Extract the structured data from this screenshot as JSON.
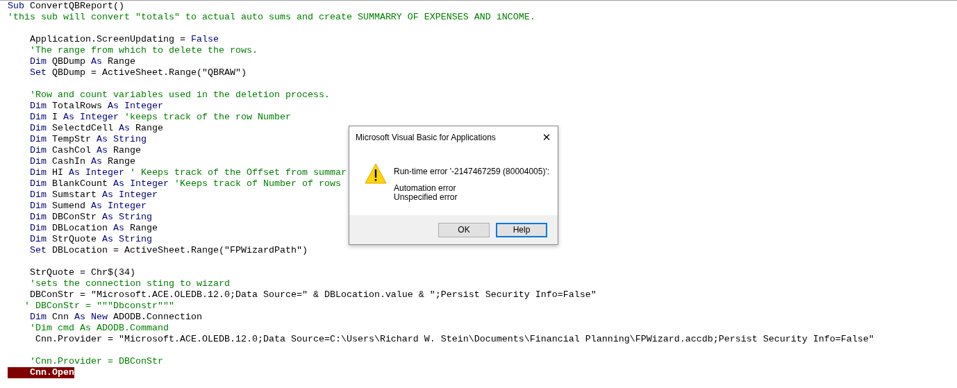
{
  "code_editor": {
    "lines": [
      {
        "kind": "code",
        "current": false,
        "segments": [
          {
            "kind": "keyword",
            "text": "Sub"
          },
          {
            "kind": "plain",
            "text": " ConvertQBReport()"
          }
        ]
      },
      {
        "kind": "code",
        "current": false,
        "segments": [
          {
            "kind": "comment",
            "text": "'this sub will convert \"totals\" to actual auto sums and create SUMMARRY OF EXPENSES AND iNCOME."
          }
        ]
      },
      {
        "kind": "blank"
      },
      {
        "kind": "code",
        "current": false,
        "segments": [
          {
            "kind": "plain",
            "text": "    Application.ScreenUpdating = "
          },
          {
            "kind": "keyword",
            "text": "False"
          }
        ]
      },
      {
        "kind": "code",
        "current": false,
        "segments": [
          {
            "kind": "comment",
            "text": "    'The range from which to delete the rows."
          }
        ]
      },
      {
        "kind": "code",
        "current": false,
        "segments": [
          {
            "kind": "keyword",
            "text": "    Dim"
          },
          {
            "kind": "plain",
            "text": " QBDump "
          },
          {
            "kind": "keyword",
            "text": "As"
          },
          {
            "kind": "plain",
            "text": " Range"
          }
        ]
      },
      {
        "kind": "code",
        "current": false,
        "segments": [
          {
            "kind": "keyword",
            "text": "    Set"
          },
          {
            "kind": "plain",
            "text": " QBDump = ActiveSheet.Range(\"QBRAW\")"
          }
        ]
      },
      {
        "kind": "blank"
      },
      {
        "kind": "code",
        "current": false,
        "segments": [
          {
            "kind": "comment",
            "text": "    'Row and count variables used in the deletion process."
          }
        ]
      },
      {
        "kind": "code",
        "current": false,
        "segments": [
          {
            "kind": "keyword",
            "text": "    Dim"
          },
          {
            "kind": "plain",
            "text": " TotalRows "
          },
          {
            "kind": "keyword",
            "text": "As Integer"
          }
        ]
      },
      {
        "kind": "code",
        "current": false,
        "segments": [
          {
            "kind": "keyword",
            "text": "    Dim"
          },
          {
            "kind": "plain",
            "text": " I "
          },
          {
            "kind": "keyword",
            "text": "As Integer"
          },
          {
            "kind": "comment",
            "text": " 'keeps track of the row Number"
          }
        ]
      },
      {
        "kind": "code",
        "current": false,
        "segments": [
          {
            "kind": "keyword",
            "text": "    Dim"
          },
          {
            "kind": "plain",
            "text": " SelectdCell "
          },
          {
            "kind": "keyword",
            "text": "As"
          },
          {
            "kind": "plain",
            "text": " Range"
          }
        ]
      },
      {
        "kind": "code",
        "current": false,
        "segments": [
          {
            "kind": "keyword",
            "text": "    Dim"
          },
          {
            "kind": "plain",
            "text": " TempStr "
          },
          {
            "kind": "keyword",
            "text": "As String"
          }
        ]
      },
      {
        "kind": "code",
        "current": false,
        "segments": [
          {
            "kind": "keyword",
            "text": "    Dim"
          },
          {
            "kind": "plain",
            "text": " CashCol "
          },
          {
            "kind": "keyword",
            "text": "As"
          },
          {
            "kind": "plain",
            "text": " Range"
          }
        ]
      },
      {
        "kind": "code",
        "current": false,
        "segments": [
          {
            "kind": "keyword",
            "text": "    Dim"
          },
          {
            "kind": "plain",
            "text": " CashIn "
          },
          {
            "kind": "keyword",
            "text": "As"
          },
          {
            "kind": "plain",
            "text": " Range"
          }
        ]
      },
      {
        "kind": "code",
        "current": false,
        "segments": [
          {
            "kind": "keyword",
            "text": "    Dim"
          },
          {
            "kind": "plain",
            "text": " HI "
          },
          {
            "kind": "keyword",
            "text": "As Integer"
          },
          {
            "kind": "comment",
            "text": " ' Keeps track of the Offset from summar"
          }
        ]
      },
      {
        "kind": "code",
        "current": false,
        "segments": [
          {
            "kind": "keyword",
            "text": "    Dim"
          },
          {
            "kind": "plain",
            "text": " BlankCount "
          },
          {
            "kind": "keyword",
            "text": "As Integer"
          },
          {
            "kind": "comment",
            "text": " 'Keeps track of Number of rows"
          }
        ]
      },
      {
        "kind": "code",
        "current": false,
        "segments": [
          {
            "kind": "keyword",
            "text": "    Dim"
          },
          {
            "kind": "plain",
            "text": " Sumstart "
          },
          {
            "kind": "keyword",
            "text": "As Integer"
          }
        ]
      },
      {
        "kind": "code",
        "current": false,
        "segments": [
          {
            "kind": "keyword",
            "text": "    Dim"
          },
          {
            "kind": "plain",
            "text": " Sumend "
          },
          {
            "kind": "keyword",
            "text": "As Integer"
          }
        ]
      },
      {
        "kind": "code",
        "current": false,
        "segments": [
          {
            "kind": "keyword",
            "text": "    Dim"
          },
          {
            "kind": "plain",
            "text": " DBConStr "
          },
          {
            "kind": "keyword",
            "text": "As String"
          }
        ]
      },
      {
        "kind": "code",
        "current": false,
        "segments": [
          {
            "kind": "keyword",
            "text": "    Dim"
          },
          {
            "kind": "plain",
            "text": " DBLocation "
          },
          {
            "kind": "keyword",
            "text": "As"
          },
          {
            "kind": "plain",
            "text": " Range"
          }
        ]
      },
      {
        "kind": "code",
        "current": false,
        "segments": [
          {
            "kind": "keyword",
            "text": "    Dim"
          },
          {
            "kind": "plain",
            "text": " StrQuote "
          },
          {
            "kind": "keyword",
            "text": "As String"
          }
        ]
      },
      {
        "kind": "code",
        "current": false,
        "segments": [
          {
            "kind": "keyword",
            "text": "    Set"
          },
          {
            "kind": "plain",
            "text": " DBLocation = ActiveSheet.Range(\"FPWizardPath\")"
          }
        ]
      },
      {
        "kind": "blank"
      },
      {
        "kind": "code",
        "current": false,
        "segments": [
          {
            "kind": "plain",
            "text": "    StrQuote = Chr$(34)"
          }
        ]
      },
      {
        "kind": "code",
        "current": false,
        "segments": [
          {
            "kind": "comment",
            "text": "    'sets the connection sting to wizard"
          }
        ]
      },
      {
        "kind": "code",
        "current": false,
        "segments": [
          {
            "kind": "plain",
            "text": "    DBConStr = \"Microsoft.ACE.OLEDB.12.0;Data Source=\" & DBLocation.value & \";Persist Security Info=False\""
          }
        ]
      },
      {
        "kind": "code",
        "current": false,
        "segments": [
          {
            "kind": "comment",
            "text": "   ' DBConStr = \"\"\"Dbconstr\"\"\""
          }
        ]
      },
      {
        "kind": "code",
        "current": false,
        "segments": [
          {
            "kind": "keyword",
            "text": "    Dim"
          },
          {
            "kind": "plain",
            "text": " Cnn "
          },
          {
            "kind": "keyword",
            "text": "As New"
          },
          {
            "kind": "plain",
            "text": " ADODB.Connection"
          }
        ]
      },
      {
        "kind": "code",
        "current": false,
        "segments": [
          {
            "kind": "comment",
            "text": "    'Dim cmd As ADODB.Command"
          }
        ]
      },
      {
        "kind": "code",
        "current": false,
        "segments": [
          {
            "kind": "plain",
            "text": "     Cnn.Provider = \"Microsoft.ACE.OLEDB.12.0;Data Source=C:\\Users\\Richard W. Stein\\Documents\\Financial Planning\\FPWizard.accdb;Persist Security Info=False\""
          }
        ]
      },
      {
        "kind": "blank"
      },
      {
        "kind": "code",
        "current": false,
        "segments": [
          {
            "kind": "comment",
            "text": "    'Cnn.Provider = DBConStr"
          }
        ]
      },
      {
        "kind": "code",
        "current": true,
        "segments": [
          {
            "kind": "plain",
            "text": "    Cnn.Open"
          }
        ]
      }
    ]
  },
  "dialog": {
    "title": "Microsoft Visual Basic for Applications",
    "close": "✕",
    "error_code": "Run-time error '-2147467259 (80004005)':",
    "message": [
      "Automation error",
      "Unspecified error"
    ],
    "buttons": [
      {
        "label": "OK",
        "focused": false
      },
      {
        "label": "Help",
        "focused": true
      }
    ]
  }
}
